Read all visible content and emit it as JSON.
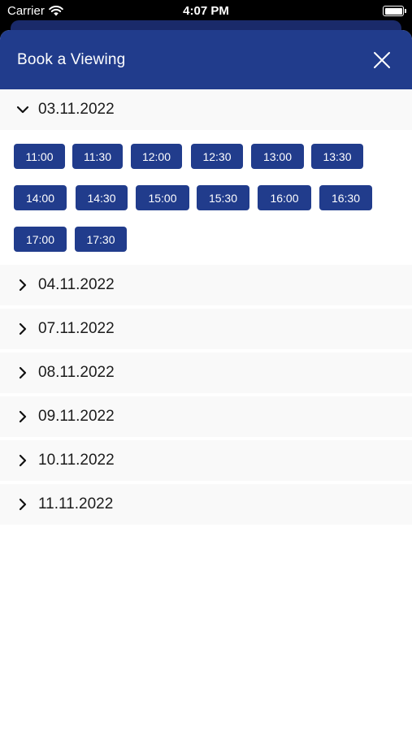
{
  "status_bar": {
    "carrier": "Carrier",
    "time": "4:07 PM"
  },
  "header": {
    "title": "Book a Viewing",
    "close_icon": "close-icon"
  },
  "expanded_date": {
    "label": "03.11.2022",
    "slots": [
      "11:00",
      "11:30",
      "12:00",
      "12:30",
      "13:00",
      "13:30",
      "14:00",
      "14:30",
      "15:00",
      "15:30",
      "16:00",
      "16:30",
      "17:00",
      "17:30"
    ]
  },
  "collapsed_dates": [
    "04.11.2022",
    "07.11.2022",
    "08.11.2022",
    "09.11.2022",
    "10.11.2022",
    "11.11.2022"
  ],
  "colors": {
    "brand": "#213c8c",
    "row_bg": "#f9f9f9"
  }
}
